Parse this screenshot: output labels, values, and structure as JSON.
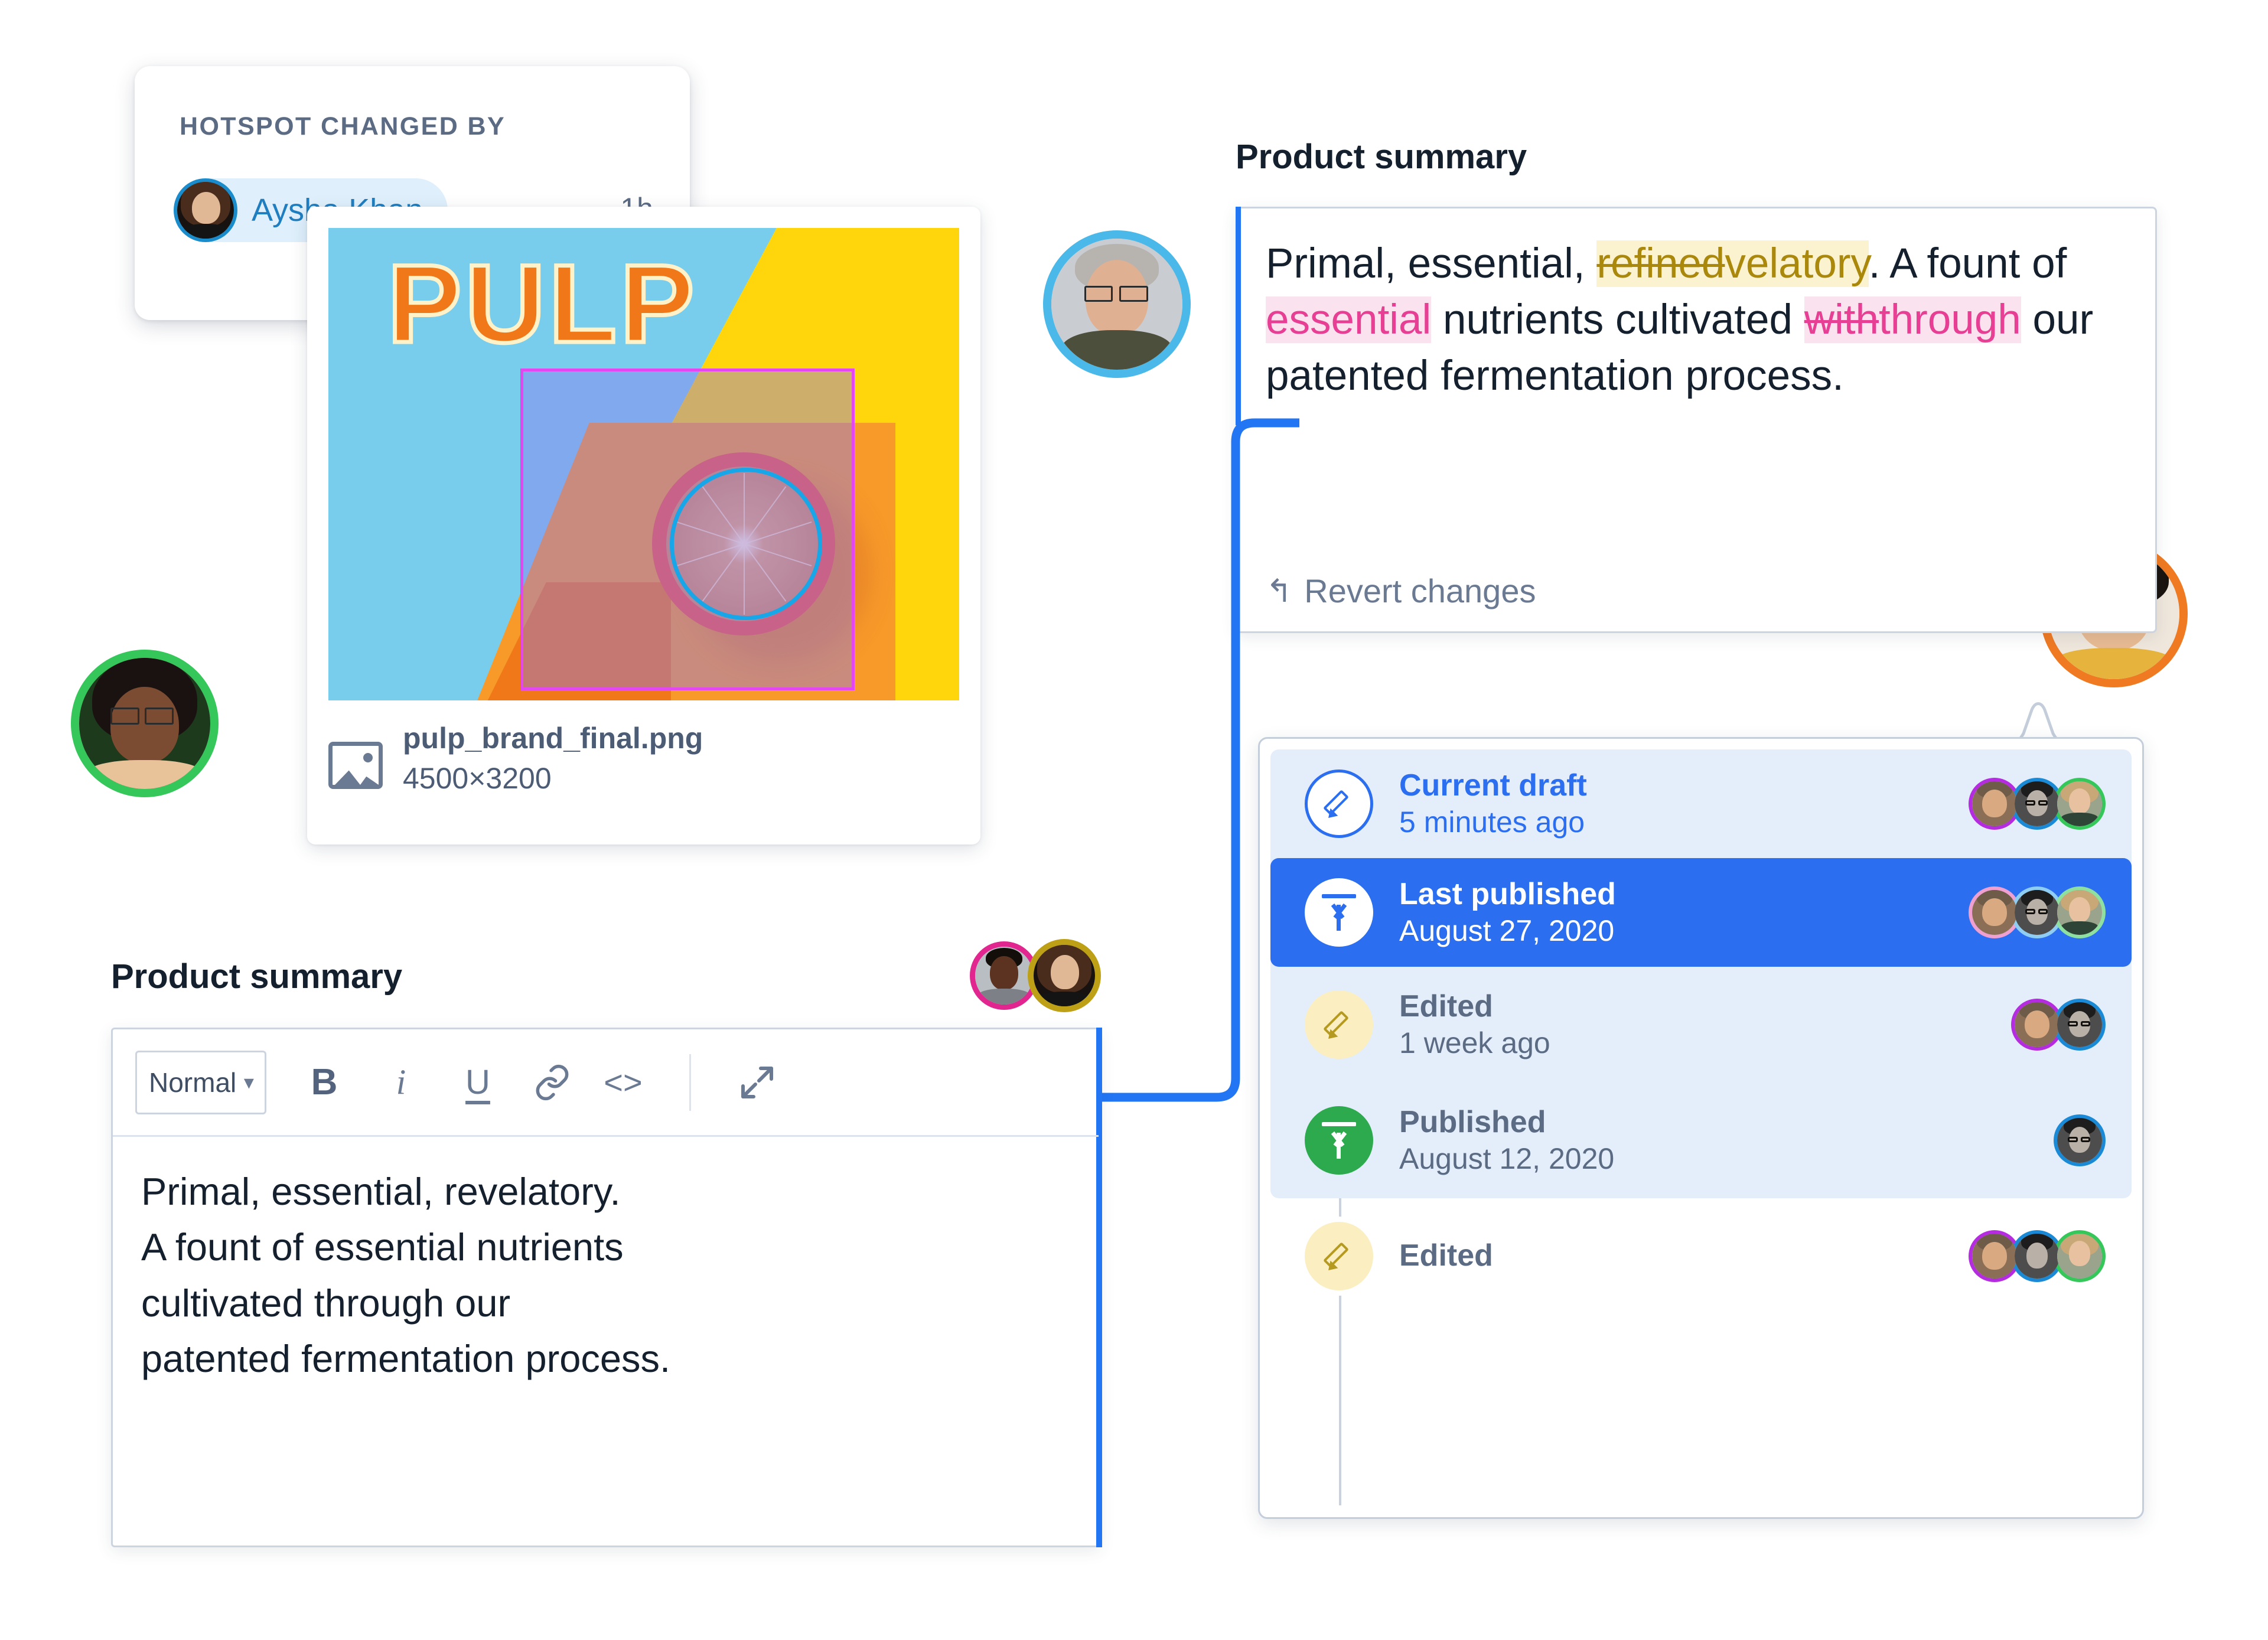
{
  "hotspot_tooltip": {
    "title": "HOTSPOT CHANGED BY",
    "user": "Aysha Khan",
    "timestamp": "1h",
    "ring_color": "#1a8ccc",
    "chip_bg": "#dff0fc"
  },
  "asset_card": {
    "filename": "pulp_brand_final.png",
    "dimensions": "4500×3200",
    "artwork_word": "PULP",
    "file_icon": "image-icon",
    "hotspot_rect_color": "#e446ef",
    "hotspot_circle_color": "#17a6e8"
  },
  "diff_card": {
    "title": "Product summary",
    "line1_pre": "Primal, essential, ",
    "line1_del": "refined",
    "line1_ins": "velatory",
    "line1_post": ".",
    "line2_pre": "A fount of ",
    "line2_ins": "essential",
    "line2_post": " nutrients",
    "line3_pre": "cultivated ",
    "line3_del": "with",
    "line3_ins": "through",
    "line3_post": " our",
    "line4": "patented fermentation process.",
    "revert_label": "Revert changes",
    "revert_icon": "undo-icon",
    "yellow_text": "#a9880c",
    "yellow_bg": "#fbf2cf",
    "pink_text": "#e63f93",
    "pink_bg": "#fbe2ef",
    "accent": "#2276f4"
  },
  "editor": {
    "title": "Product summary",
    "toolbar": {
      "style_label": "Normal",
      "style_chevron": "chevron-down-icon",
      "bold": "B",
      "italic": "i",
      "underline": "U",
      "link": "link-icon",
      "code": "<>",
      "expand": "expand-icon"
    },
    "body": "Primal, essential, revelatory.\nA fount of essential nutrients\ncultivated through our\npatented fermentation process.",
    "avatars": [
      {
        "name": "avatar-pink-ring",
        "ring": "#e2268f"
      },
      {
        "name": "avatar-gold-ring",
        "ring": "#bda015"
      }
    ]
  },
  "history": {
    "rows": [
      {
        "label": "Current draft",
        "meta": "5 minutes ago",
        "icon": "pencil-icon",
        "state": "draft",
        "avatars": [
          "#b52ce0",
          "#1b8ad6",
          "#35c75a"
        ]
      },
      {
        "label": "Last published",
        "meta": "August 27, 2020",
        "icon": "upload-icon",
        "state": "selected",
        "avatars": [
          "#f0a0d0",
          "#8fcdf2",
          "#8ee0a0"
        ]
      },
      {
        "label": "Edited",
        "meta": "1 week ago",
        "icon": "pencil-icon",
        "state": "edited",
        "avatars": [
          "#b52ce0",
          "#1b8ad6"
        ]
      },
      {
        "label": "Published",
        "meta": "August 12, 2020",
        "icon": "upload-icon",
        "state": "published",
        "avatars": [
          "#1b8ad6"
        ]
      },
      {
        "label": "Edited",
        "meta": "",
        "icon": "pencil-icon",
        "state": "edited",
        "avatars": [
          "#b52ce0",
          "#1b8ad6",
          "#35c75a"
        ]
      }
    ],
    "selected_bg": "#2c6ef0",
    "group_bg": "#e4eefb"
  },
  "presence_avatars": [
    {
      "name": "presence-avatar-blue",
      "ring": "#4ab8e8"
    },
    {
      "name": "presence-avatar-green",
      "ring": "#35c75a"
    },
    {
      "name": "presence-avatar-orange",
      "ring": "#f07a22"
    }
  ]
}
